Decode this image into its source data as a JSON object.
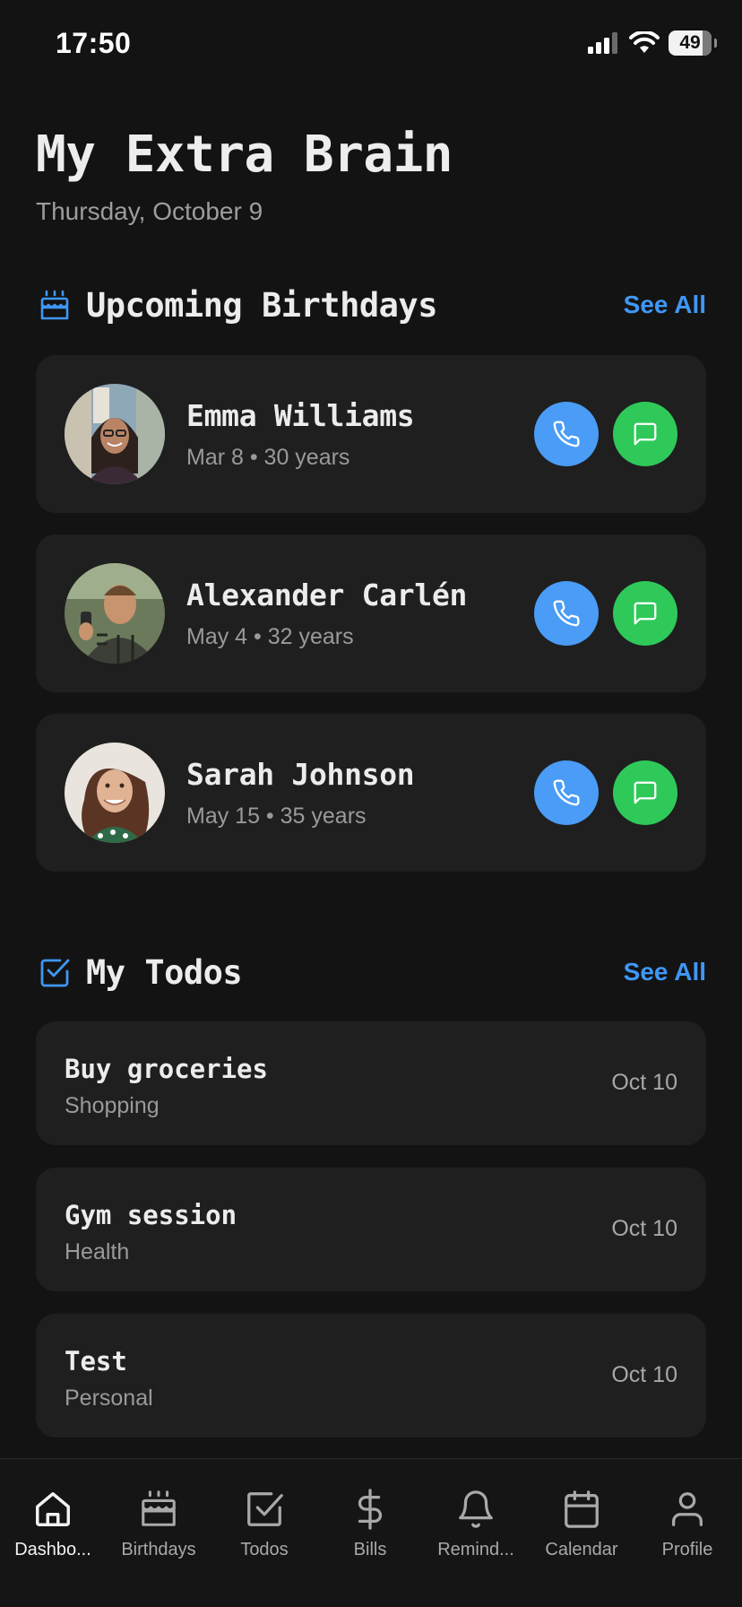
{
  "status": {
    "time": "17:50",
    "battery": "49"
  },
  "header": {
    "title": "My Extra Brain",
    "date": "Thursday, October 9"
  },
  "birthdays": {
    "title": "Upcoming Birthdays",
    "see_all": "See All",
    "items": [
      {
        "name": "Emma Williams",
        "meta": "Mar 8 • 30 years"
      },
      {
        "name": "Alexander Carlén",
        "meta": "May 4 • 32 years"
      },
      {
        "name": "Sarah Johnson",
        "meta": "May 15 • 35 years"
      }
    ]
  },
  "todos": {
    "title": "My Todos",
    "see_all": "See All",
    "items": [
      {
        "title": "Buy groceries",
        "category": "Shopping",
        "date": "Oct 10"
      },
      {
        "title": "Gym session",
        "category": "Health",
        "date": "Oct 10"
      },
      {
        "title": "Test",
        "category": "Personal",
        "date": "Oct 10"
      }
    ]
  },
  "tabs": [
    {
      "label": "Dashbo...",
      "icon": "home-icon",
      "active": true
    },
    {
      "label": "Birthdays",
      "icon": "cake-icon"
    },
    {
      "label": "Todos",
      "icon": "checkbox-icon"
    },
    {
      "label": "Bills",
      "icon": "dollar-icon"
    },
    {
      "label": "Remind...",
      "icon": "bell-icon"
    },
    {
      "label": "Calendar",
      "icon": "calendar-icon"
    },
    {
      "label": "Profile",
      "icon": "person-icon"
    }
  ],
  "colors": {
    "accent_blue": "#3f97f5",
    "call_blue": "#4a9cf6",
    "message_green": "#2fc95a",
    "card": "#1f1f1f",
    "background": "#131313"
  }
}
